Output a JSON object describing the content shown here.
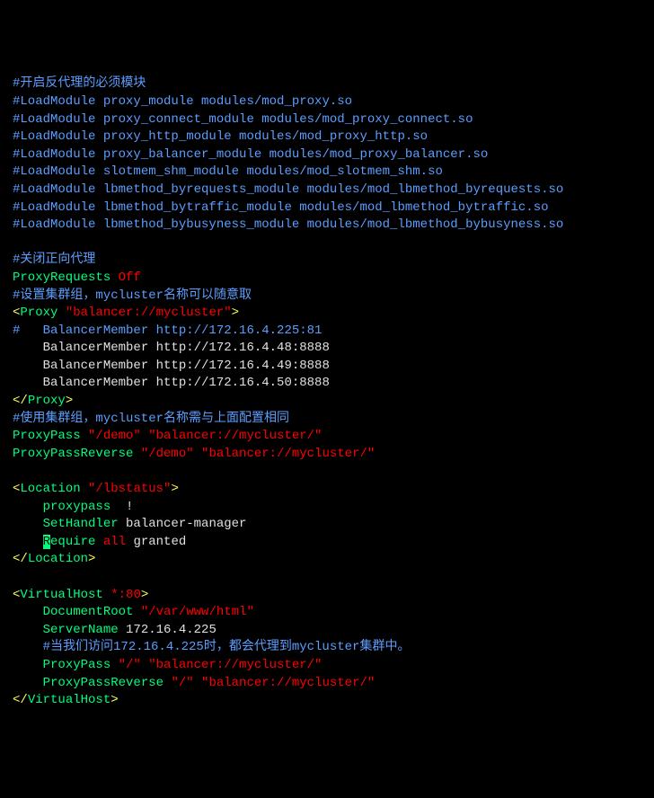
{
  "lines": {
    "l1": "#开启反代理的必须模块",
    "l2": "#LoadModule proxy_module modules/mod_proxy.so",
    "l3": "#LoadModule proxy_connect_module modules/mod_proxy_connect.so",
    "l4": "#LoadModule proxy_http_module modules/mod_proxy_http.so",
    "l5": "#LoadModule proxy_balancer_module modules/mod_proxy_balancer.so",
    "l6": "#LoadModule slotmem_shm_module modules/mod_slotmem_shm.so",
    "l7": "#LoadModule lbmethod_byrequests_module modules/mod_lbmethod_byrequests.so",
    "l8": "#LoadModule lbmethod_bytraffic_module modules/mod_lbmethod_bytraffic.so",
    "l9": "#LoadModule lbmethod_bybusyness_module modules/mod_lbmethod_bybusyness.so",
    "l10_blank": " ",
    "l11": "#关闭正向代理",
    "l12_a": "ProxyRequests ",
    "l12_b": "Off",
    "l13": "#设置集群组，mycluster名称可以随意取",
    "l14_a": "<",
    "l14_b": "Proxy ",
    "l14_c": "\"balancer://mycluster\"",
    "l14_d": ">",
    "l15": "#   BalancerMember http://172.16.4.225:81",
    "l16": "    BalancerMember http://172.16.4.48:8888",
    "l17": "    BalancerMember http://172.16.4.49:8888",
    "l18": "    BalancerMember http://172.16.4.50:8888",
    "l19_a": "</",
    "l19_b": "Proxy",
    "l19_c": ">",
    "l20": "#使用集群组，mycluster名称需与上面配置相同",
    "l21_a": "ProxyPass ",
    "l21_b": "\"/demo\" \"balancer://mycluster/\"",
    "l22_a": "ProxyPassReverse ",
    "l22_b": "\"/demo\" \"balancer://mycluster/\"",
    "l23_blank": " ",
    "l24_a": "<",
    "l24_b": "Location ",
    "l24_c": "\"/lbstatus\"",
    "l24_d": ">",
    "l25_sp": "    ",
    "l25_a": "proxypass ",
    "l25_b": " !",
    "l26_sp": "    ",
    "l26_a": "SetHandler",
    "l26_b": " balancer-manager",
    "l27_sp": "    ",
    "l27_a": "R",
    "l27_b": "equire ",
    "l27_c": "all",
    "l27_d": " granted",
    "l28_a": "</",
    "l28_b": "Location",
    "l28_c": ">",
    "l29_blank": " ",
    "l30_a": "<",
    "l30_b": "VirtualHost ",
    "l30_c": "*:80",
    "l30_d": ">",
    "l31_sp": "    ",
    "l31_a": "DocumentRoot ",
    "l31_b": "\"/var/www/html\"",
    "l32_sp": "    ",
    "l32_a": "ServerName",
    "l32_b": " 172.16.4.225",
    "l33_sp": "    ",
    "l33": "#当我们访问172.16.4.225时，都会代理到mycluster集群中。",
    "l34_sp": "    ",
    "l34_a": "ProxyPass ",
    "l34_b": "\"/\" \"balancer://mycluster/\"",
    "l35_sp": "    ",
    "l35_a": "ProxyPassReverse ",
    "l35_b": "\"/\" \"balancer://mycluster/\"",
    "l36_a": "</",
    "l36_b": "VirtualHost",
    "l36_c": ">"
  }
}
